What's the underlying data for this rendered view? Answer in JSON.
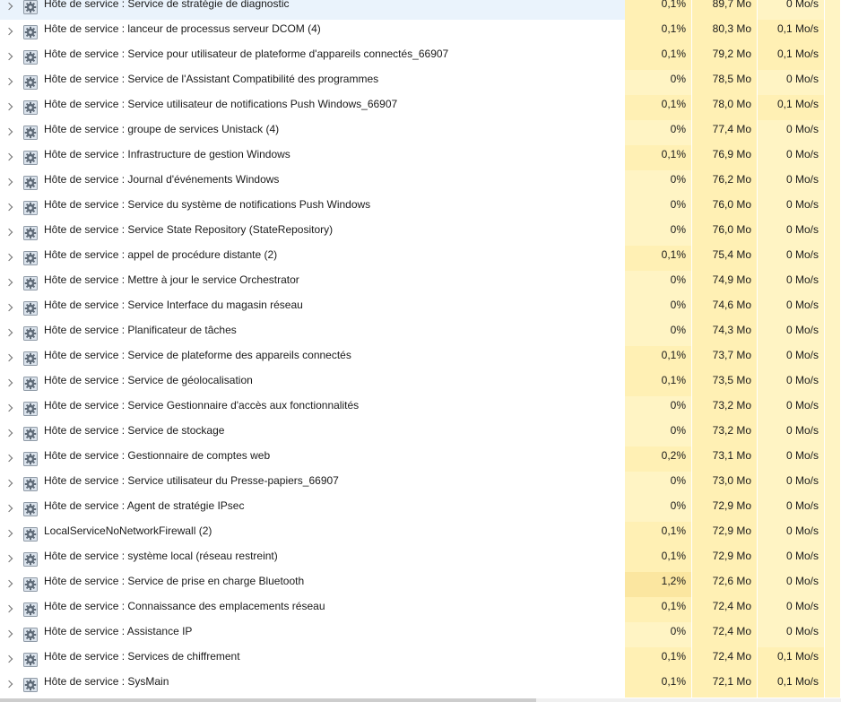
{
  "colors": {
    "selected_row": "#eaf3fc",
    "heat_low": "#fff4c4",
    "heat_mid": "#fff0b4",
    "heat_high": "#fbe6a0",
    "text": "#1a1a1a"
  },
  "icons": {
    "expand": "chevron-right-icon",
    "process": "gear-icon"
  },
  "processes": [
    {
      "name": "Hôte de service : Service de stratégie de diagnostic",
      "cpu": "0,1%",
      "memory": "89,7 Mo",
      "disk": "0 Mo/s",
      "selected": true
    },
    {
      "name": "Hôte de service : lanceur de processus serveur DCOM (4)",
      "cpu": "0,1%",
      "memory": "80,3 Mo",
      "disk": "0,1 Mo/s"
    },
    {
      "name": "Hôte de service : Service pour utilisateur de plateforme d'appareils connectés_66907",
      "cpu": "0,1%",
      "memory": "79,2 Mo",
      "disk": "0,1 Mo/s"
    },
    {
      "name": "Hôte de service : Service de l'Assistant Compatibilité des programmes",
      "cpu": "0%",
      "memory": "78,5 Mo",
      "disk": "0 Mo/s"
    },
    {
      "name": "Hôte de service : Service utilisateur de notifications Push Windows_66907",
      "cpu": "0,1%",
      "memory": "78,0 Mo",
      "disk": "0,1 Mo/s"
    },
    {
      "name": "Hôte de service : groupe de services Unistack (4)",
      "cpu": "0%",
      "memory": "77,4 Mo",
      "disk": "0 Mo/s"
    },
    {
      "name": "Hôte de service : Infrastructure de gestion Windows",
      "cpu": "0,1%",
      "memory": "76,9 Mo",
      "disk": "0 Mo/s"
    },
    {
      "name": "Hôte de service : Journal d'événements Windows",
      "cpu": "0%",
      "memory": "76,2 Mo",
      "disk": "0 Mo/s"
    },
    {
      "name": "Hôte de service : Service du système de notifications Push Windows",
      "cpu": "0%",
      "memory": "76,0 Mo",
      "disk": "0 Mo/s"
    },
    {
      "name": "Hôte de service : Service State Repository (StateRepository)",
      "cpu": "0%",
      "memory": "76,0 Mo",
      "disk": "0 Mo/s"
    },
    {
      "name": "Hôte de service : appel de procédure distante (2)",
      "cpu": "0,1%",
      "memory": "75,4 Mo",
      "disk": "0 Mo/s"
    },
    {
      "name": "Hôte de service : Mettre à jour le service Orchestrator",
      "cpu": "0%",
      "memory": "74,9 Mo",
      "disk": "0 Mo/s"
    },
    {
      "name": "Hôte de service : Service Interface du magasin réseau",
      "cpu": "0%",
      "memory": "74,6 Mo",
      "disk": "0 Mo/s"
    },
    {
      "name": "Hôte de service : Planificateur de tâches",
      "cpu": "0%",
      "memory": "74,3 Mo",
      "disk": "0 Mo/s"
    },
    {
      "name": "Hôte de service : Service de plateforme des appareils connectés",
      "cpu": "0,1%",
      "memory": "73,7 Mo",
      "disk": "0 Mo/s"
    },
    {
      "name": "Hôte de service : Service de géolocalisation",
      "cpu": "0,1%",
      "memory": "73,5 Mo",
      "disk": "0 Mo/s"
    },
    {
      "name": "Hôte de service : Service Gestionnaire d'accès aux fonctionnalités",
      "cpu": "0%",
      "memory": "73,2 Mo",
      "disk": "0 Mo/s"
    },
    {
      "name": "Hôte de service : Service de stockage",
      "cpu": "0%",
      "memory": "73,2 Mo",
      "disk": "0 Mo/s"
    },
    {
      "name": "Hôte de service : Gestionnaire de comptes web",
      "cpu": "0,2%",
      "memory": "73,1 Mo",
      "disk": "0 Mo/s"
    },
    {
      "name": "Hôte de service : Service utilisateur du Presse-papiers_66907",
      "cpu": "0%",
      "memory": "73,0 Mo",
      "disk": "0 Mo/s"
    },
    {
      "name": "Hôte de service : Agent de stratégie IPsec",
      "cpu": "0%",
      "memory": "72,9 Mo",
      "disk": "0 Mo/s"
    },
    {
      "name": "LocalServiceNoNetworkFirewall (2)",
      "cpu": "0,1%",
      "memory": "72,9 Mo",
      "disk": "0 Mo/s"
    },
    {
      "name": "Hôte de service : système local (réseau restreint)",
      "cpu": "0,1%",
      "memory": "72,9 Mo",
      "disk": "0 Mo/s"
    },
    {
      "name": "Hôte de service : Service de prise en charge Bluetooth",
      "cpu": "1,2%",
      "memory": "72,6 Mo",
      "disk": "0 Mo/s"
    },
    {
      "name": "Hôte de service : Connaissance des emplacements réseau",
      "cpu": "0,1%",
      "memory": "72,4 Mo",
      "disk": "0 Mo/s"
    },
    {
      "name": "Hôte de service : Assistance IP",
      "cpu": "0%",
      "memory": "72,4 Mo",
      "disk": "0 Mo/s"
    },
    {
      "name": "Hôte de service : Services de chiffrement",
      "cpu": "0,1%",
      "memory": "72,4 Mo",
      "disk": "0,1 Mo/s"
    },
    {
      "name": "Hôte de service : SysMain",
      "cpu": "0,1%",
      "memory": "72,1 Mo",
      "disk": "0,1 Mo/s"
    }
  ]
}
